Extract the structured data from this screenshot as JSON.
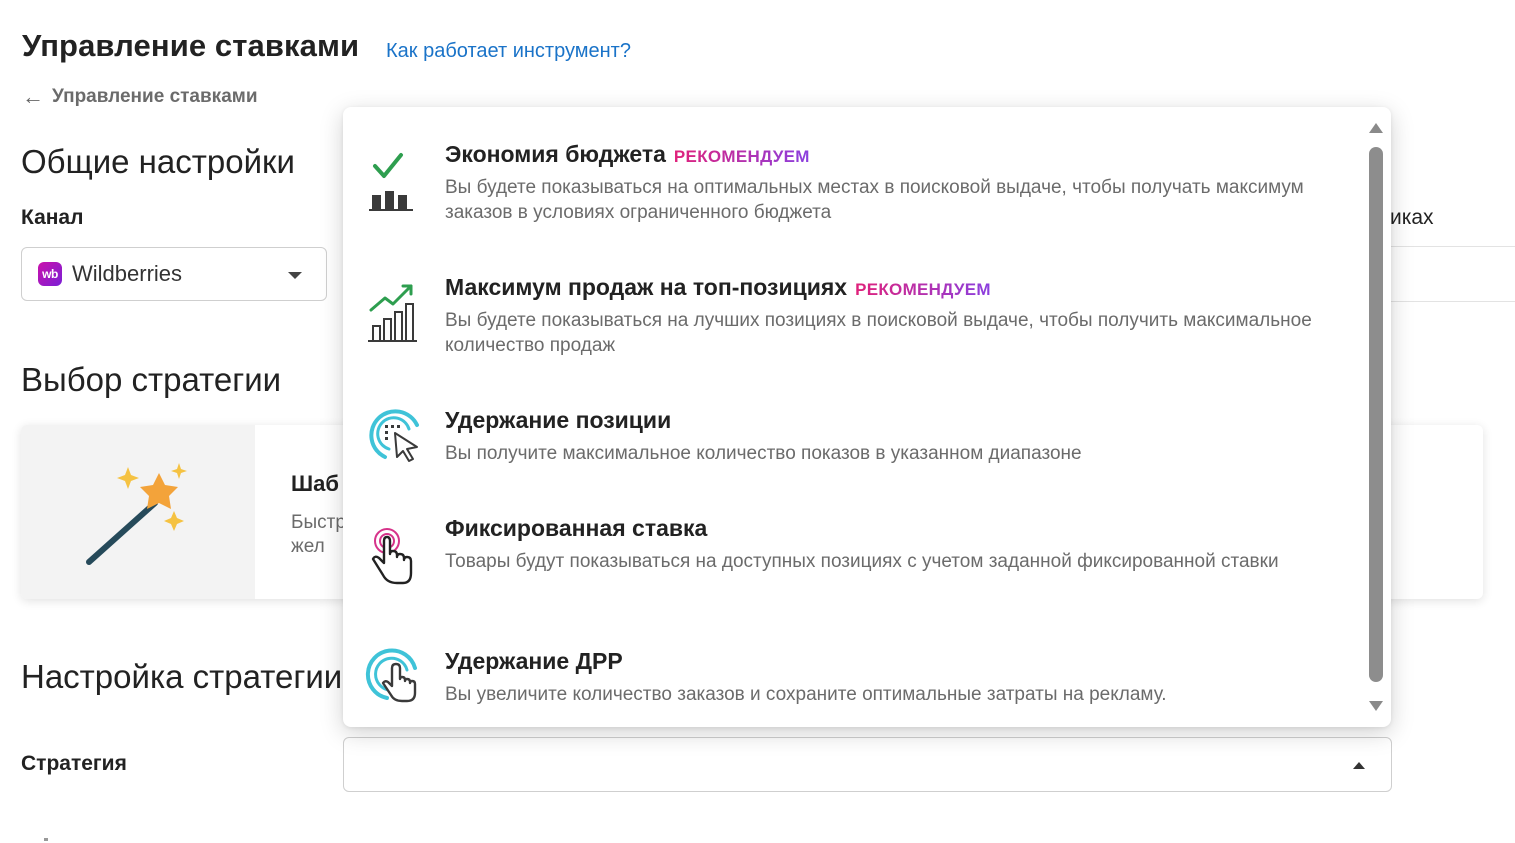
{
  "header": {
    "title": "Управление ставками",
    "help_link": "Как работает инструмент?",
    "breadcrumb": "Управление ставками"
  },
  "general": {
    "section_title": "Общие настройки",
    "channel_label": "Канал",
    "channel_value": "Wildberries",
    "channel_logo_text": "wb",
    "right_partial_text": "иках"
  },
  "strategy_choice": {
    "section_title": "Выбор стратегии",
    "card_title": "Шаб",
    "card_desc": "Быстр и жел"
  },
  "strategy_setup": {
    "section_title": "Настройка стратегии",
    "strategy_label": "Стратегия",
    "strategy_value": ""
  },
  "dropdown": {
    "options": [
      {
        "title": "Экономия бюджета",
        "badge": "РЕКОМЕНДУЕМ",
        "description": "Вы будете показываться на оптимальных местах в поисковой выдаче, чтобы получать максимум заказов в условиях ограниченного бюджета",
        "icon": "budget-chart-icon"
      },
      {
        "title": "Максимум продаж на топ-позициях",
        "badge": "РЕКОМЕНДУЕМ",
        "description": "Вы будете показываться на лучших позициях в поисковой выдаче, чтобы получить максимальное количество продаж",
        "icon": "growth-chart-icon"
      },
      {
        "title": "Удержание позиции",
        "badge": "",
        "description": "Вы получите максимальное количество показов в указанном диапазоне",
        "icon": "target-cursor-icon"
      },
      {
        "title": "Фиксированная ставка",
        "badge": "",
        "description": "Товары будут показываться на доступных позициях с учетом заданной фиксированной ставки",
        "icon": "tap-hand-icon"
      },
      {
        "title": "Удержание ДРР",
        "badge": "",
        "description": "Вы увеличите количество заказов и сохраните оптимальные затраты на рекламу.",
        "icon": "click-hand-icon"
      }
    ]
  },
  "colors": {
    "link": "#1a73c8",
    "badge_start": "#e0217a",
    "badge_end": "#8a3fe0",
    "icon_green": "#2e9e4f",
    "icon_dark": "#3a3a3a",
    "icon_cyan": "#3fc3d8",
    "icon_pink": "#d6338a"
  }
}
